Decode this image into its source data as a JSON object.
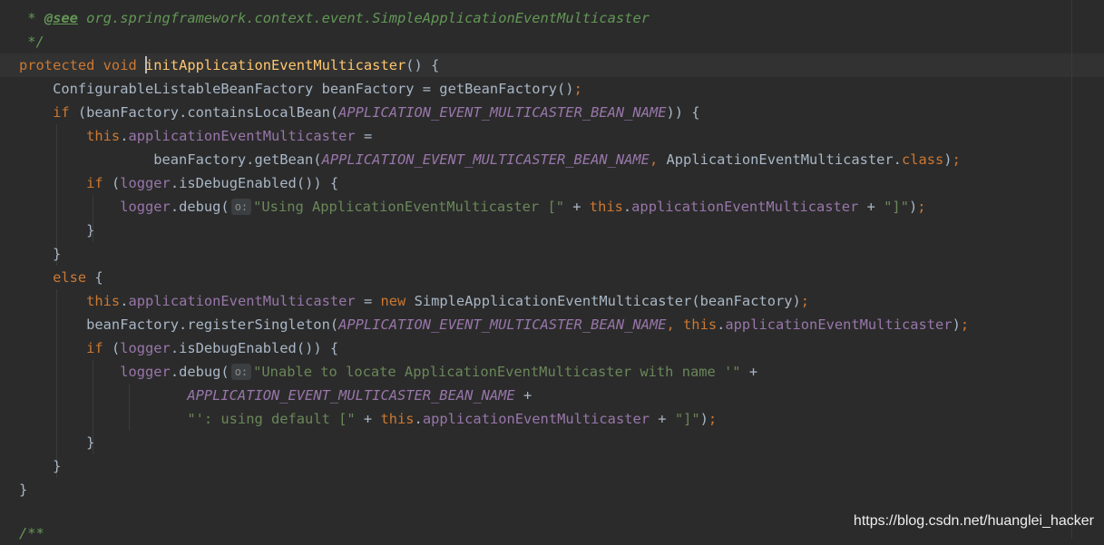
{
  "code": {
    "l1": {
      "star": " * ",
      "see": "@see",
      "ref": " org.springframework.context.event.SimpleApplicationEventMulticaster"
    },
    "l2": {
      "close": " */"
    },
    "l3": {
      "kw": "protected void ",
      "name": "initApplicationEventMulticaster",
      "rest": "() {"
    },
    "l4": {
      "text": "    ConfigurableListableBeanFactory beanFactory = getBeanFactory()",
      "semi": ";"
    },
    "l5": {
      "kw": "    if",
      "a": " (beanFactory.containsLocalBean(",
      "c": "APPLICATION_EVENT_MULTICASTER_BEAN_NAME",
      "b": ")) {"
    },
    "l6": {
      "kw": "        this",
      "dot": ".",
      "f": "applicationEventMulticaster",
      "b": " ="
    },
    "l7": {
      "a": "                beanFactory.getBean(",
      "c": "APPLICATION_EVENT_MULTICASTER_BEAN_NAME",
      "comma": ",",
      "b": " ApplicationEventMulticaster.",
      "kw": "class",
      "end": ")",
      "semi": ";"
    },
    "l8": {
      "kw": "        if",
      "a": " (",
      "f": "logger",
      "b": ".isDebugEnabled()) {"
    },
    "l9": {
      "ind": "            ",
      "f": "logger",
      "a": ".debug(",
      "hint": "o:",
      "s": "\"Using ApplicationEventMulticaster [\"",
      "plus": " + ",
      "kw": "this",
      "dot": ".",
      "f2": "applicationEventMulticaster",
      "p2": " + ",
      "s2": "\"]\"",
      "end": ")",
      "semi": ";"
    },
    "l10": {
      "text": "        }"
    },
    "l11": {
      "text": "    }"
    },
    "l12": {
      "kw": "    else",
      "b": " {"
    },
    "l13": {
      "kw": "        this",
      "dot": ".",
      "f": "applicationEventMulticaster",
      "a": " = ",
      "kw2": "new",
      "b": " SimpleApplicationEventMulticaster(beanFactory)",
      "semi": ";"
    },
    "l14": {
      "a": "        beanFactory.registerSingleton(",
      "c": "APPLICATION_EVENT_MULTICASTER_BEAN_NAME",
      "comma": ", ",
      "kw": "this",
      "dot": ".",
      "f": "applicationEventMulticaster",
      "end": ")",
      "semi": ";"
    },
    "l15": {
      "kw": "        if",
      "a": " (",
      "f": "logger",
      "b": ".isDebugEnabled()) {"
    },
    "l16": {
      "ind": "            ",
      "f": "logger",
      "a": ".debug(",
      "hint": "o:",
      "s": "\"Unable to locate ApplicationEventMulticaster with name '\"",
      "b": " +"
    },
    "l17": {
      "ind": "                    ",
      "c": "APPLICATION_EVENT_MULTICASTER_BEAN_NAME",
      "b": " +"
    },
    "l18": {
      "ind": "                    ",
      "s": "\"': using default [\"",
      "plus": " + ",
      "kw": "this",
      "dot": ".",
      "f": "applicationEventMulticaster",
      "p2": " + ",
      "s2": "\"]\"",
      "end": ")",
      "semi": ";"
    },
    "l19": {
      "text": "        }"
    },
    "l20": {
      "text": "    }"
    },
    "l21": {
      "text": "}"
    },
    "l22": {
      "text": "/**"
    }
  },
  "watermark": "https://blog.csdn.net/huanglei_hacker",
  "colors": {
    "background": "#2b2b2b",
    "keyword": "#cc7832",
    "field": "#9876aa",
    "string": "#6a8759",
    "doc_comment": "#629755",
    "method_declaration": "#ffc66d",
    "default_text": "#a9b7c6"
  }
}
